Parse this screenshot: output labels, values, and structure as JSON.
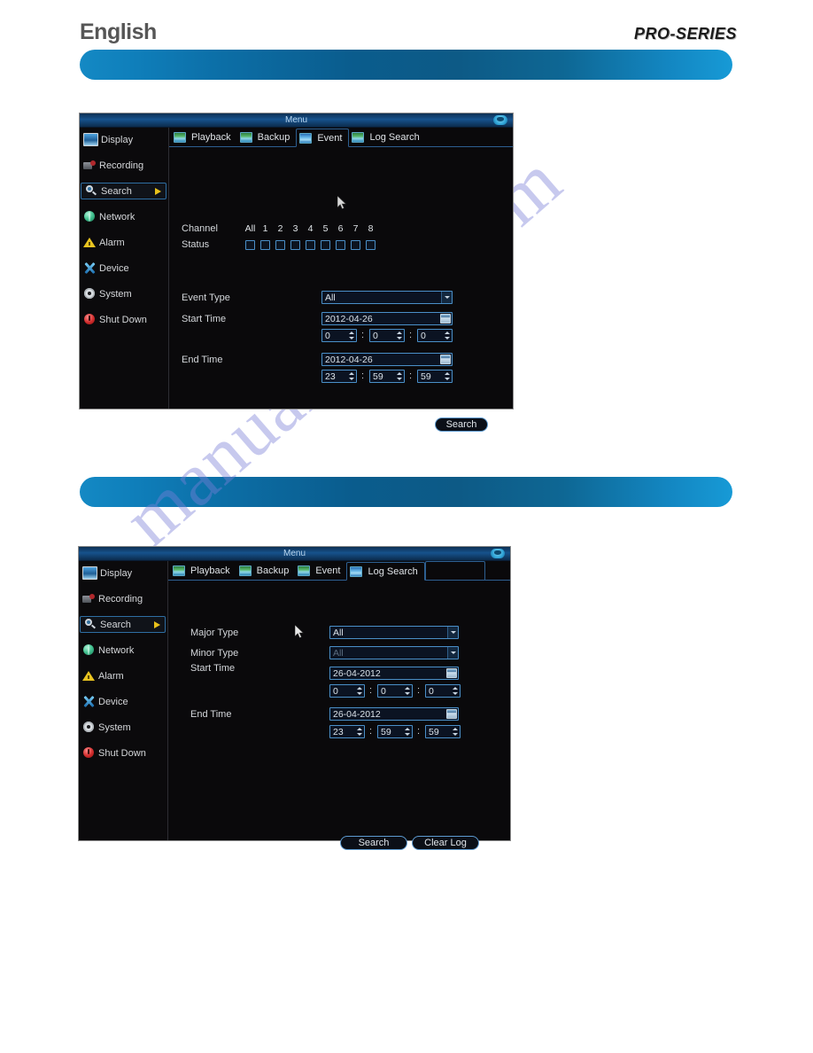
{
  "header": {
    "language": "English",
    "brand": "PRO-SERIES"
  },
  "watermark": "manualshive.com",
  "icons": {
    "titlebar": "wifi-icon",
    "calendar": "calendar-icon",
    "cursor": "mouse-cursor-icon"
  },
  "sidebar": {
    "items": [
      {
        "label": "Display",
        "icon": "monitor-icon",
        "active": false
      },
      {
        "label": "Recording",
        "icon": "camera-icon",
        "active": false
      },
      {
        "label": "Search",
        "icon": "magnifier-icon",
        "active": true
      },
      {
        "label": "Network",
        "icon": "globe-icon",
        "active": false
      },
      {
        "label": "Alarm",
        "icon": "warning-triangle-icon",
        "active": false
      },
      {
        "label": "Device",
        "icon": "tools-icon",
        "active": false
      },
      {
        "label": "System",
        "icon": "gear-icon",
        "active": false
      },
      {
        "label": "Shut Down",
        "icon": "power-icon",
        "active": false
      }
    ]
  },
  "panel_event": {
    "window_title": "Menu",
    "tabs": [
      {
        "label": "Playback",
        "active": false
      },
      {
        "label": "Backup",
        "active": false
      },
      {
        "label": "Event",
        "active": true
      },
      {
        "label": "Log Search",
        "active": false
      }
    ],
    "channel": {
      "label": "Channel",
      "status_label": "Status",
      "numbers": [
        "All",
        "1",
        "2",
        "3",
        "4",
        "5",
        "6",
        "7",
        "8"
      ],
      "checked": [
        false,
        false,
        false,
        false,
        false,
        false,
        false,
        false,
        false
      ]
    },
    "event_type": {
      "label": "Event Type",
      "value": "All"
    },
    "start_time": {
      "label": "Start Time",
      "date": "2012-04-26",
      "hour": "0",
      "minute": "0",
      "second": "0"
    },
    "end_time": {
      "label": "End Time",
      "date": "2012-04-26",
      "hour": "23",
      "minute": "59",
      "second": "59"
    },
    "buttons": {
      "search": "Search"
    }
  },
  "panel_log_search": {
    "window_title": "Menu",
    "tabs": [
      {
        "label": "Playback",
        "active": false
      },
      {
        "label": "Backup",
        "active": false
      },
      {
        "label": "Event",
        "active": false
      },
      {
        "label": "Log Search",
        "active": true
      }
    ],
    "major_type": {
      "label": "Major Type",
      "value": "All",
      "disabled": false
    },
    "minor_type": {
      "label": "Minor Type",
      "value": "All",
      "disabled": true
    },
    "start_time": {
      "label": "Start Time",
      "date": "26-04-2012",
      "hour": "0",
      "minute": "0",
      "second": "0"
    },
    "end_time": {
      "label": "End Time",
      "date": "26-04-2012",
      "hour": "23",
      "minute": "59",
      "second": "59"
    },
    "buttons": {
      "search": "Search",
      "clear_log": "Clear Log"
    }
  },
  "separators": {
    "colon": ":"
  },
  "colors": {
    "accent_blue": "#0c6ea6",
    "field_border": "#4a8fc8",
    "active_arrow": "#e8c11a",
    "watermark": "#7b80d8"
  }
}
